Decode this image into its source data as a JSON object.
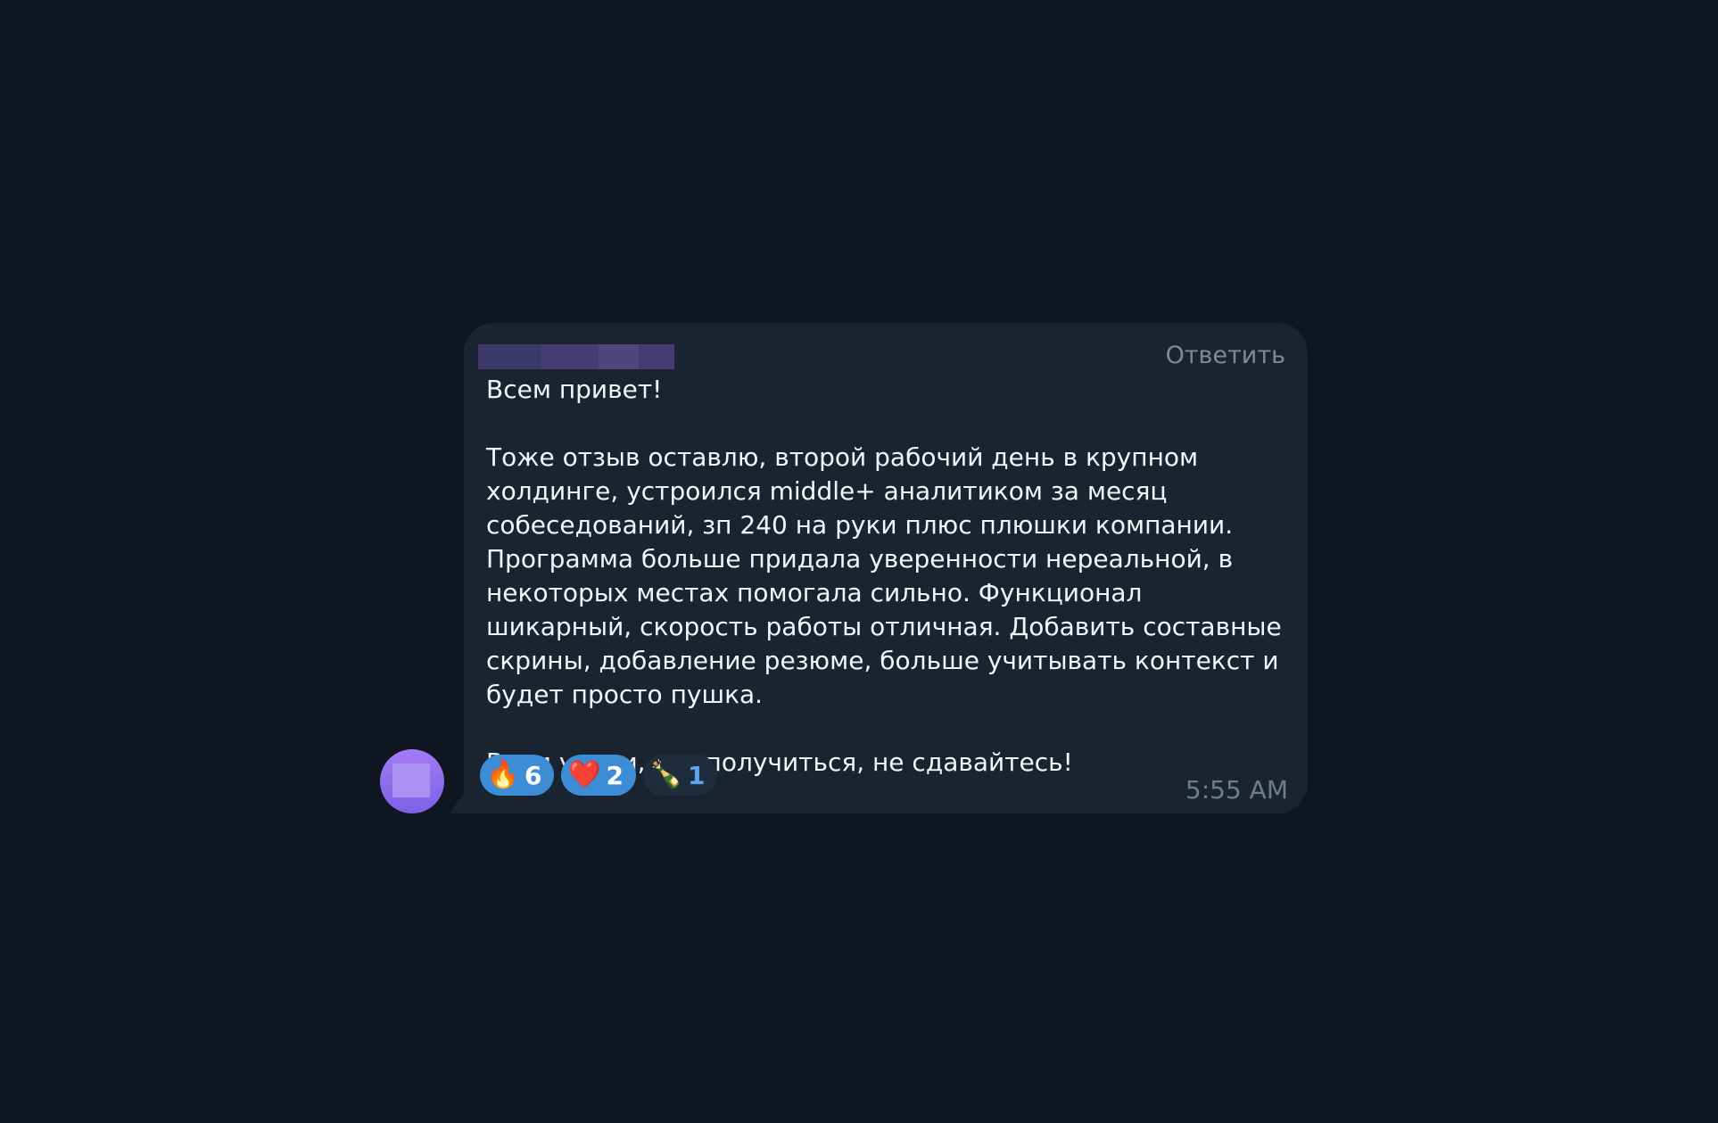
{
  "message": {
    "sender_name_redacted": true,
    "reply_label": "Ответить",
    "text": "Всем привет!\n\nТоже отзыв оставлю, второй рабочий день в крупном холдинге, устроился middle+ аналитиком за месяц собеседований, зп 240 на руки плюс плюшки компании. Программа больше придала уверенности нереальной, в некоторых местах помогала сильно. Функционал шикарный, скорость работы отличная. Добавить составные скрины, добавление резюме, больше учитывать контекст и будет просто пушка.\n\nВсем удачи, все получиться, не сдавайтесь!",
    "time": "5:55 AM",
    "reactions": [
      {
        "icon": "fire-icon",
        "glyph": "🔥",
        "count": "6",
        "active": true
      },
      {
        "icon": "heart-icon",
        "glyph": "❤️",
        "count": "2",
        "active": true
      },
      {
        "icon": "champagne-icon",
        "glyph": "🍾",
        "count": "1",
        "active": false
      }
    ]
  },
  "colors": {
    "background": "#0f1621",
    "bubble": "#192430",
    "reaction_active": "#3d8cd6",
    "reaction_inactive": "#1d2d3c",
    "avatar": "#8f6ef0",
    "redacted_name": "#4a3f78"
  }
}
